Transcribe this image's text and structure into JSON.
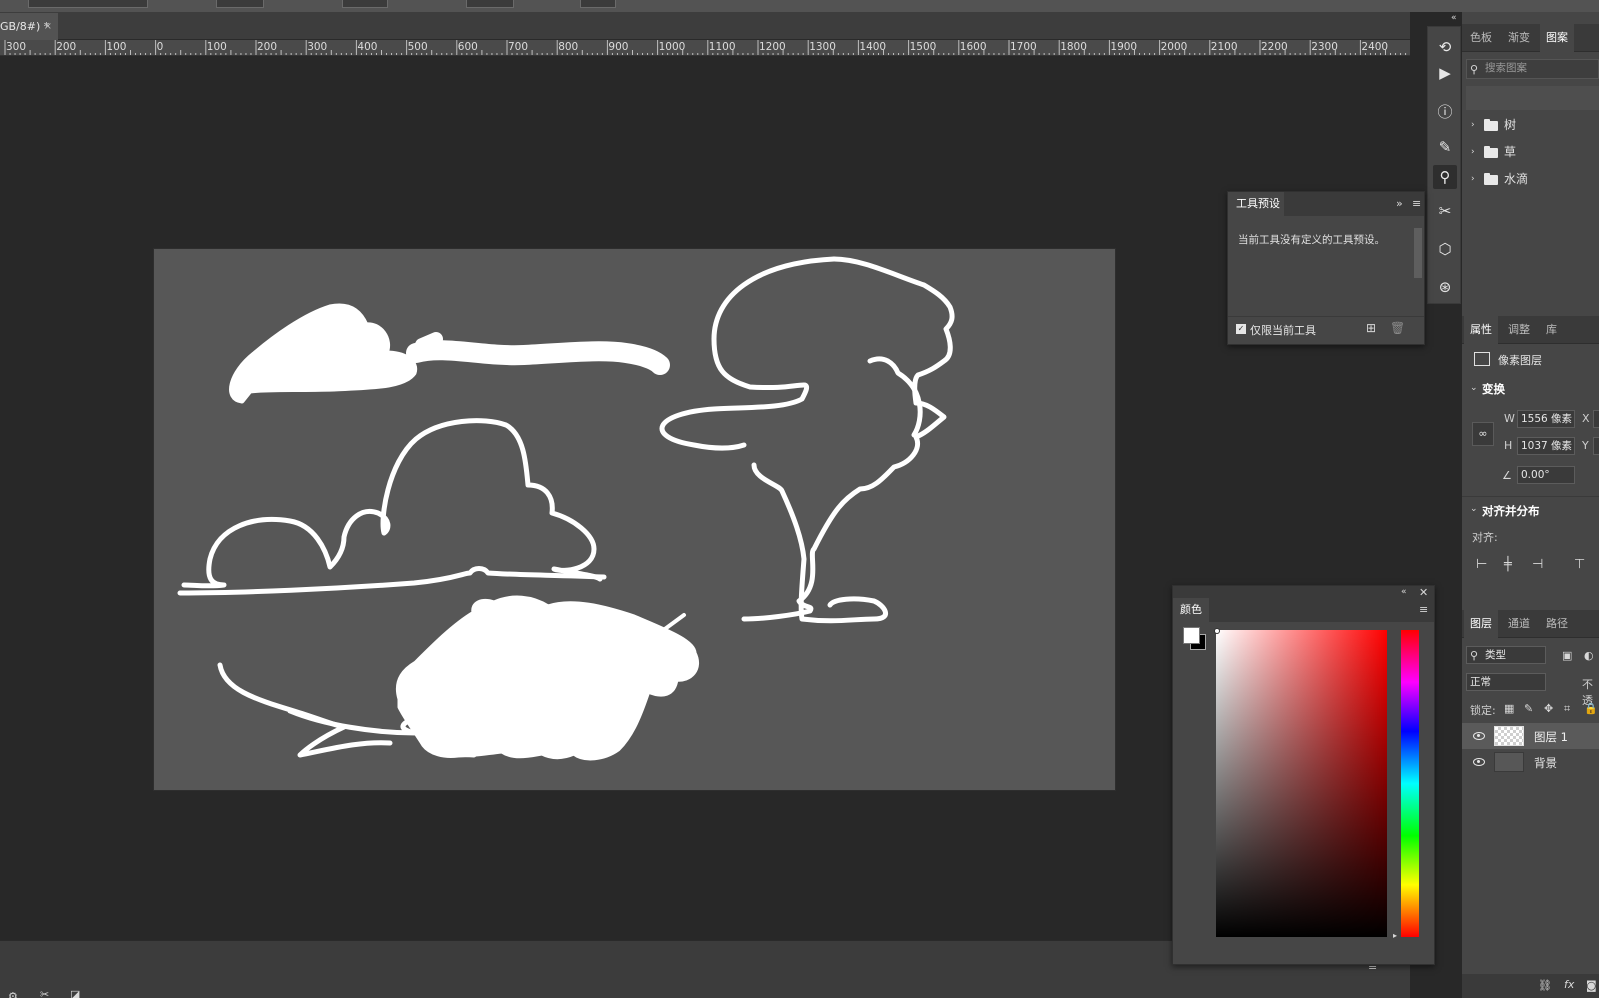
{
  "document": {
    "tab_label": "GB/8#) *",
    "tab_close": "×"
  },
  "ruler": {
    "labels": [
      "300",
      "200",
      "100",
      "0",
      "100",
      "200",
      "300",
      "400",
      "500",
      "600",
      "700",
      "800",
      "900",
      "1000",
      "1100",
      "1200",
      "1300",
      "1400",
      "1500",
      "1600",
      "1700",
      "1800",
      "1900",
      "2000",
      "2100",
      "2200",
      "2300",
      "2400"
    ]
  },
  "patterns_panel": {
    "tabs": [
      "色板",
      "渐变",
      "图案"
    ],
    "active_tab": "图案",
    "search_placeholder": "搜索图案",
    "folders": [
      "树",
      "草",
      "水滴"
    ]
  },
  "tool_presets": {
    "title": "工具预设",
    "message": "当前工具没有定义的工具预设。",
    "checkbox_label": "仅限当前工具",
    "checked": true
  },
  "properties_panel": {
    "tabs": [
      "属性",
      "调整",
      "库"
    ],
    "layer_type": "像素图层",
    "transform_head": "变换",
    "w_label": "W",
    "w_value": "1556 像素",
    "h_label": "H",
    "h_value": "1037 像素",
    "x_label": "X",
    "y_label": "Y",
    "angle_value": "0.00°",
    "align_head": "对齐并分布",
    "align_label": "对齐:"
  },
  "layers_panel": {
    "tabs": [
      "图层",
      "通道",
      "路径"
    ],
    "filter_label": "类型",
    "blend_mode": "正常",
    "opacity_label": "不透",
    "lock_label": "锁定:",
    "layers": [
      {
        "name": "图层 1",
        "selected": true
      },
      {
        "name": "背景",
        "selected": false
      }
    ]
  },
  "color_panel": {
    "title": "颜色",
    "foreground": "#ffffff",
    "background": "#000000"
  },
  "colors": {
    "workspace": "#282828",
    "canvas": "#575757",
    "panel": "#464646",
    "stroke": "#ffffff"
  }
}
